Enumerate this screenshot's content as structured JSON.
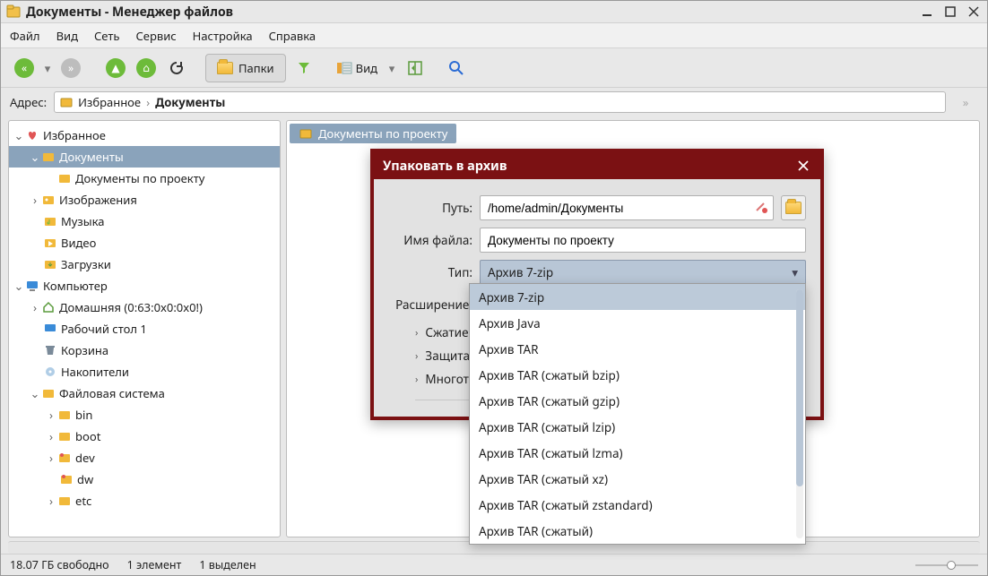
{
  "window": {
    "title": "Документы - Менеджер файлов"
  },
  "menu": {
    "file": "Файл",
    "view": "Вид",
    "network": "Сеть",
    "service": "Сервис",
    "settings": "Настройка",
    "help": "Справка"
  },
  "toolbar": {
    "folders_label": "Папки",
    "view_label": "Вид"
  },
  "address": {
    "label": "Адрес:",
    "crumb1": "Избранное",
    "crumb2": "Документы"
  },
  "content": {
    "selected_folder": "Документы по проекту"
  },
  "tree": {
    "favorites": "Избранное",
    "documents": "Документы",
    "project_docs": "Документы по проекту",
    "images": "Изображения",
    "music": "Музыка",
    "video": "Видео",
    "downloads": "Загрузки",
    "computer": "Компьютер",
    "home": "Домашняя (0:63:0x0:0x0!)",
    "desktop": "Рабочий стол 1",
    "trash": "Корзина",
    "drives": "Накопители",
    "fs": "Файловая система",
    "bin": "bin",
    "boot": "boot",
    "dev": "dev",
    "dw": "dw",
    "etc": "etc"
  },
  "dialog": {
    "title": "Упаковать в архив",
    "path_label": "Путь:",
    "path_value": "/home/admin/Документы",
    "filename_label": "Имя файла:",
    "filename_value": "Документы по проекту",
    "type_label": "Тип:",
    "type_value": "Архив 7-zip",
    "ext_label": "Расширение:",
    "exp_compress": "Сжатие",
    "exp_protect": "Защита п",
    "exp_multivol": "Многотом"
  },
  "dropdown": {
    "items": [
      "Архив 7-zip",
      "Архив Java",
      "Архив TAR",
      "Архив TAR (сжатый bzip)",
      "Архив TAR (сжатый gzip)",
      "Архив TAR (сжатый lzip)",
      "Архив TAR (сжатый lzma)",
      "Архив TAR (сжатый xz)",
      "Архив TAR (сжатый zstandard)",
      "Архив TAR (сжатый)"
    ]
  },
  "status": {
    "free": "18.07 ГБ свободно",
    "count": "1 элемент",
    "selected": "1 выделен"
  }
}
